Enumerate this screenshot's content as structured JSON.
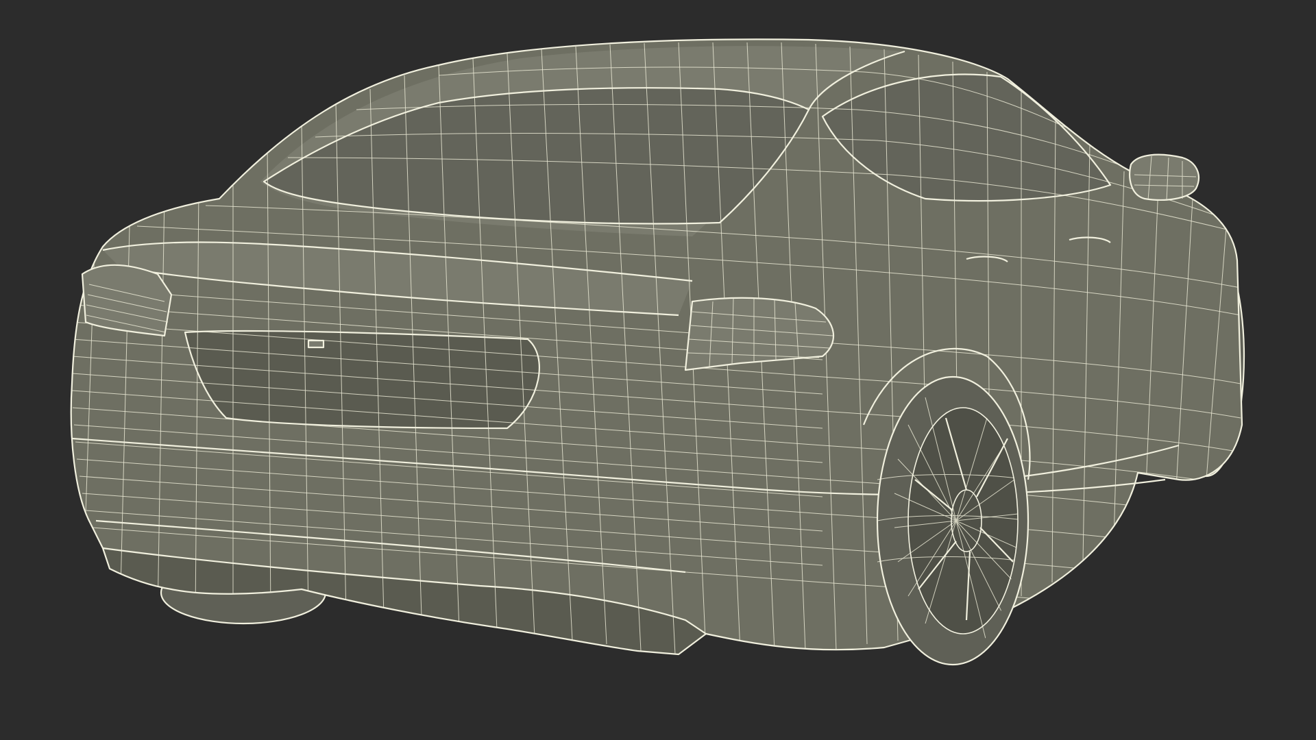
{
  "scene": {
    "subject": "car-wireframe-rear-three-quarter",
    "colors": {
      "background": "#2c2c2c",
      "surface": "#6e6f62",
      "wire": "#e9e8d4"
    }
  }
}
